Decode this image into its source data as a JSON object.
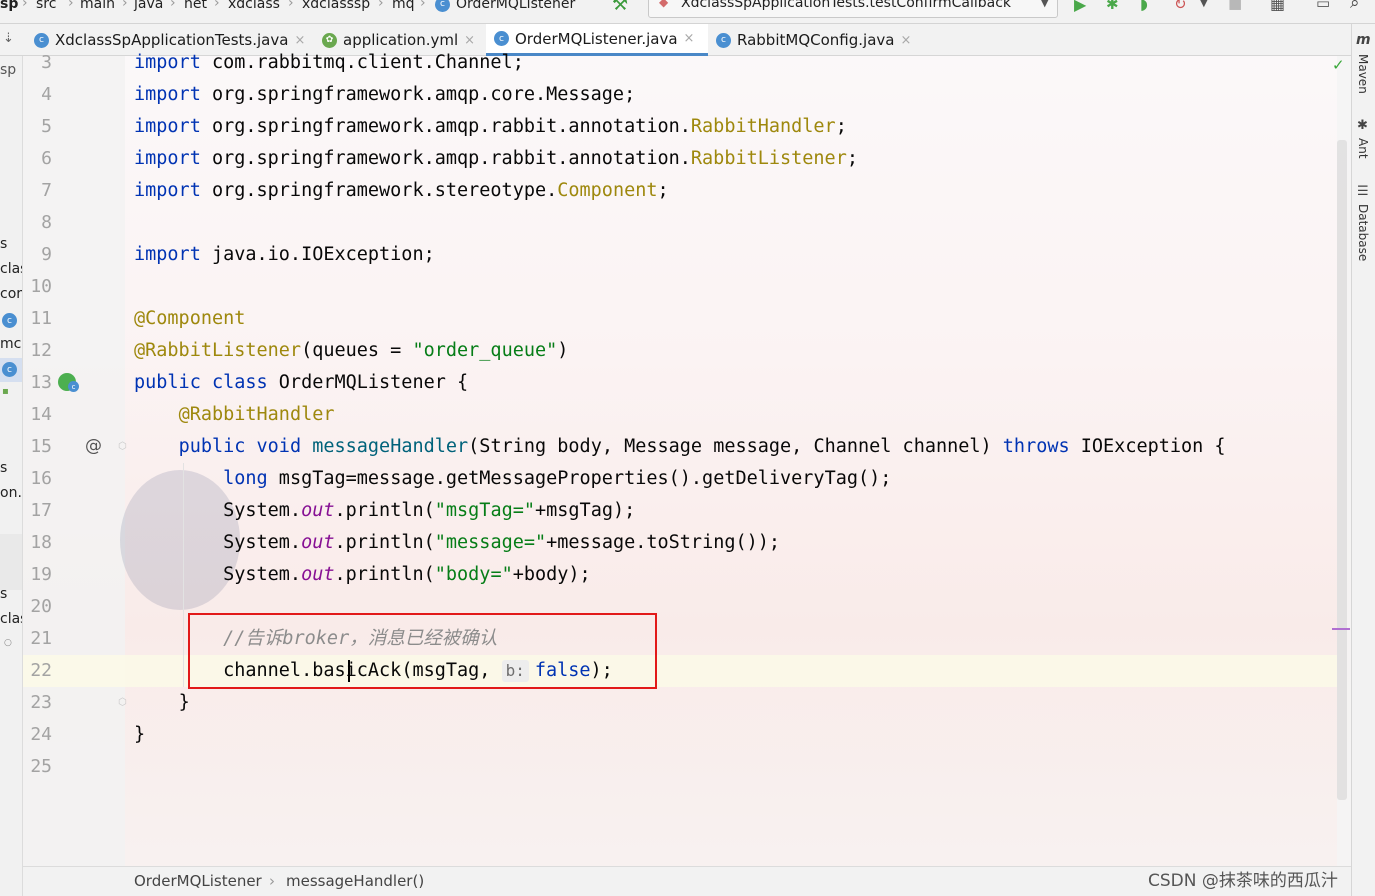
{
  "breadcrumb": [
    "sp",
    "src",
    "main",
    "java",
    "net",
    "xdclass",
    "xdclasssp",
    "mq",
    "OrderMQListener"
  ],
  "run_config": "XdclassSpApplicationTests.testConfirmCallback",
  "tabs": [
    {
      "label": "XdclassSpApplicationTests.java",
      "active": false
    },
    {
      "label": "application.yml",
      "active": false
    },
    {
      "label": "OrderMQListener.java",
      "active": true
    },
    {
      "label": "RabbitMQConfig.java",
      "active": false
    }
  ],
  "left_panel_fragments": {
    "sp": "sp",
    "s1": "s",
    "clas1": "clas",
    "cor": "cor",
    "mc": "mc",
    "s2": "s",
    "ony": "on.y",
    "s3": "s",
    "clas2": "clas"
  },
  "line_numbers": [
    "3",
    "4",
    "5",
    "6",
    "7",
    "8",
    "9",
    "10",
    "11",
    "12",
    "13",
    "14",
    "15",
    "16",
    "17",
    "18",
    "19",
    "20",
    "21",
    "22",
    "23",
    "24",
    "25"
  ],
  "code": {
    "l3": {
      "kw": "import",
      "rest": " com.rabbitmq.client.Channel;"
    },
    "l4": {
      "kw": "import",
      "rest": " org.springframework.amqp.core.Message;"
    },
    "l5": {
      "kw": "import",
      "pkg": " org.springframework.amqp.rabbit.annotation.",
      "ann": "RabbitHandler",
      "end": ";"
    },
    "l6": {
      "kw": "import",
      "pkg": " org.springframework.amqp.rabbit.annotation.",
      "ann": "RabbitListener",
      "end": ";"
    },
    "l7": {
      "kw": "import",
      "pkg": " org.springframework.stereotype.",
      "ann": "Component",
      "end": ";"
    },
    "l9": {
      "kw": "import",
      "rest": " java.io.IOException;"
    },
    "l11": {
      "ann": "@Component"
    },
    "l12": {
      "ann": "@RabbitListener",
      "a": "(queues = ",
      "str": "\"order_queue\"",
      "b": ")"
    },
    "l13": {
      "kw": "public class",
      "rest": " OrderMQListener {"
    },
    "l14": {
      "ann": "@RabbitHandler"
    },
    "l15": {
      "kw": "public void",
      "fn": " messageHandler",
      "a": "(String body, Message message, Channel channel) ",
      "kw2": "throws",
      "b": " IOException {"
    },
    "l16": {
      "kw": "long",
      "rest": " msgTag=message.getMessageProperties().getDeliveryTag();"
    },
    "l17": {
      "a": "System.",
      "st": "out",
      "b": ".println(",
      "str": "\"msgTag=\"",
      "c": "+msgTag);"
    },
    "l18": {
      "a": "System.",
      "st": "out",
      "b": ".println(",
      "str": "\"message=\"",
      "c": "+message.toString());"
    },
    "l19": {
      "a": "System.",
      "st": "out",
      "b": ".println(",
      "str": "\"body=\"",
      "c": "+body);"
    },
    "l21": {
      "cm": "//告诉broker，消息已经被确认"
    },
    "l22": {
      "a": "channel.basicAck(msgTag, ",
      "hint": "b:",
      "kw": "false",
      "b": ");"
    },
    "l23": {
      "rest": "}"
    },
    "l24": {
      "rest": "}"
    }
  },
  "gutter_marker": "@",
  "toolwindows": [
    "Maven",
    "Ant",
    "Database"
  ],
  "status_breadcrumb": [
    "OrderMQListener",
    "messageHandler()"
  ],
  "watermark": "CSDN @抹茶味的西瓜汁",
  "colors": {
    "keyword": "#0033b3",
    "annotation": "#9e880d",
    "string": "#067d17",
    "method": "#00627a",
    "static_field": "#871094",
    "comment": "#8c8c8c",
    "highlight_box": "#e21919"
  }
}
